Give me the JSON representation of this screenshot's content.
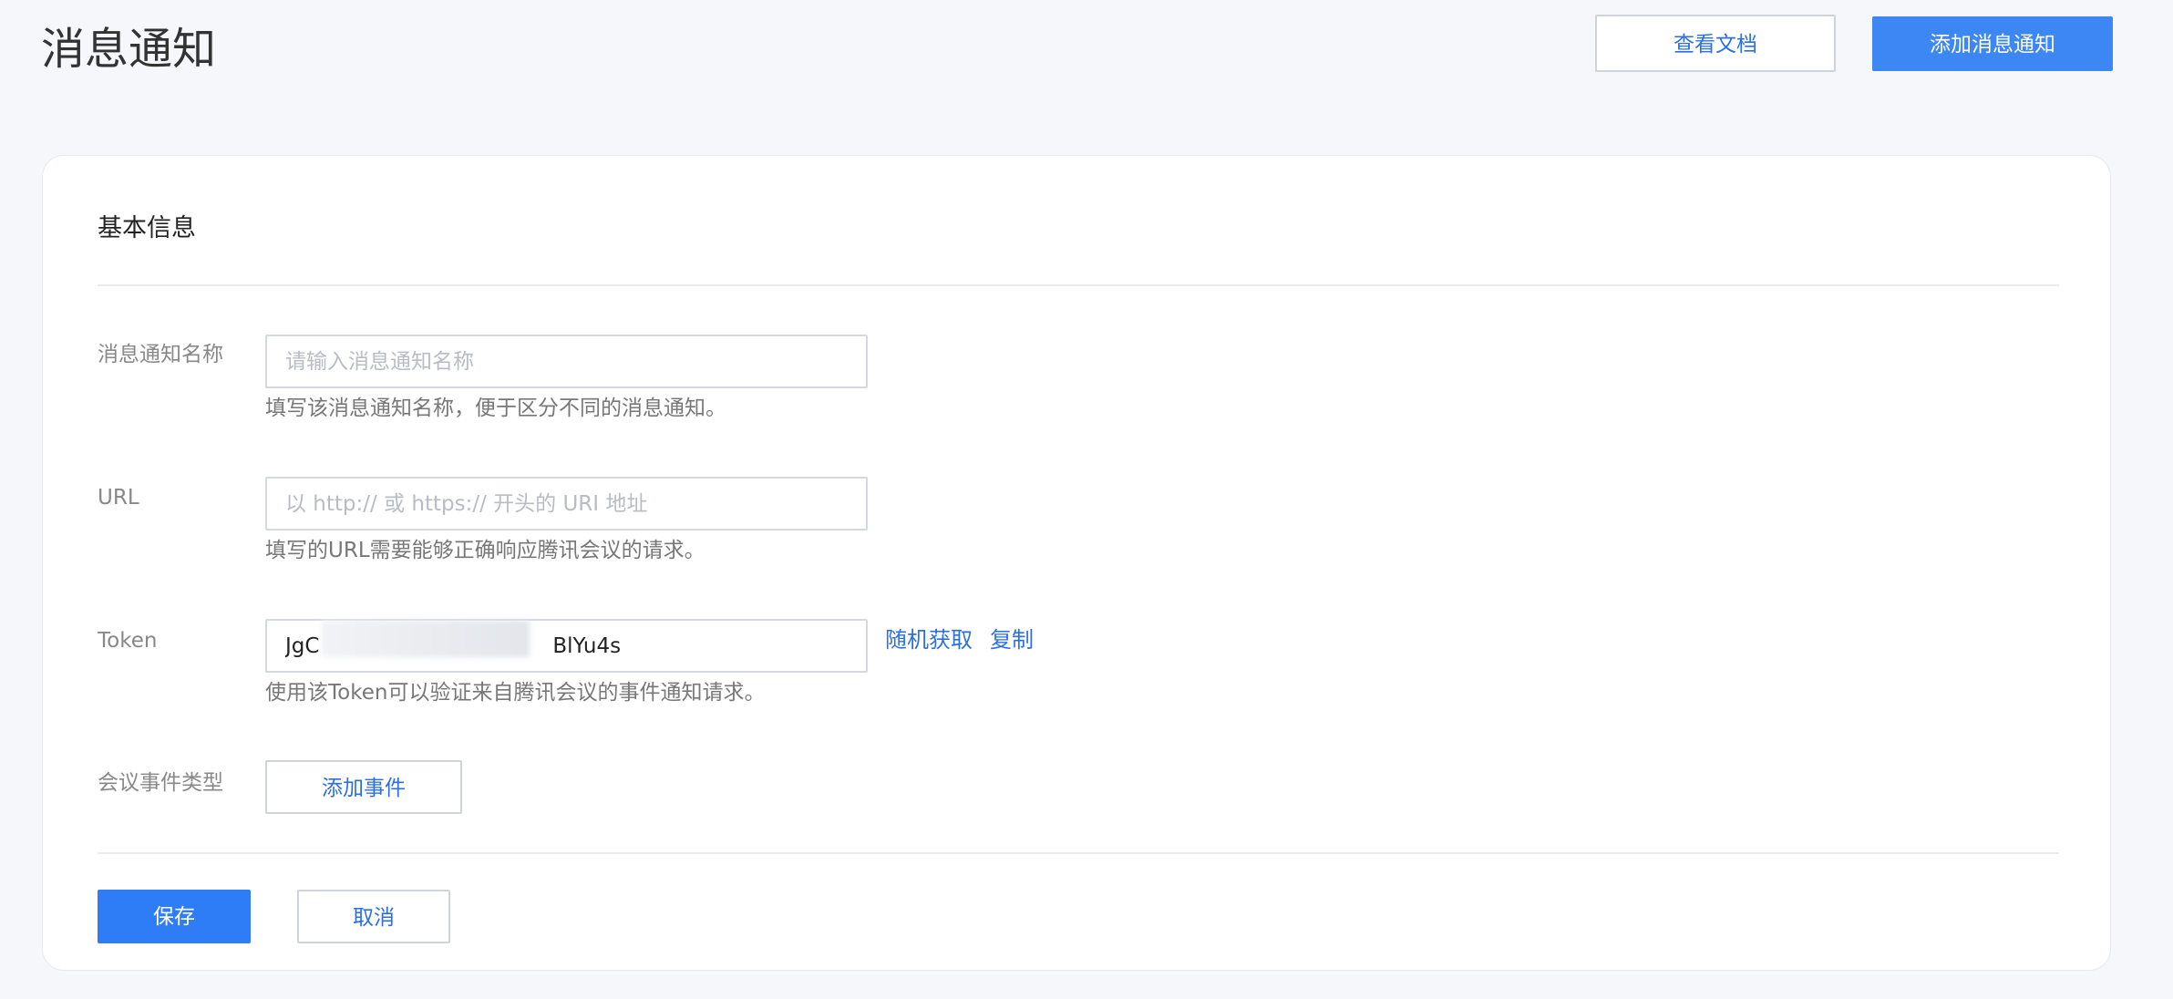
{
  "header": {
    "title": "消息通知",
    "docs_button": "查看文档",
    "add_button": "添加消息通知"
  },
  "card": {
    "section_title": "基本信息",
    "name_field": {
      "label": "消息通知名称",
      "placeholder": "请输入消息通知名称",
      "value": "",
      "hint": "填写该消息通知名称，便于区分不同的消息通知。"
    },
    "url_field": {
      "label": "URL",
      "placeholder": "以 http:// 或 https:// 开头的 URI 地址",
      "value": "",
      "hint": "填写的URL需要能够正确响应腾讯会议的请求。"
    },
    "token_field": {
      "label": "Token",
      "value": "JgC                                   BlYu4s",
      "hint": "使用该Token可以验证来自腾讯会议的事件通知请求。",
      "random_link": "随机获取",
      "copy_link": "复制"
    },
    "event_type": {
      "label": "会议事件类型",
      "add_button": "添加事件"
    },
    "actions": {
      "save": "保存",
      "cancel": "取消"
    }
  }
}
